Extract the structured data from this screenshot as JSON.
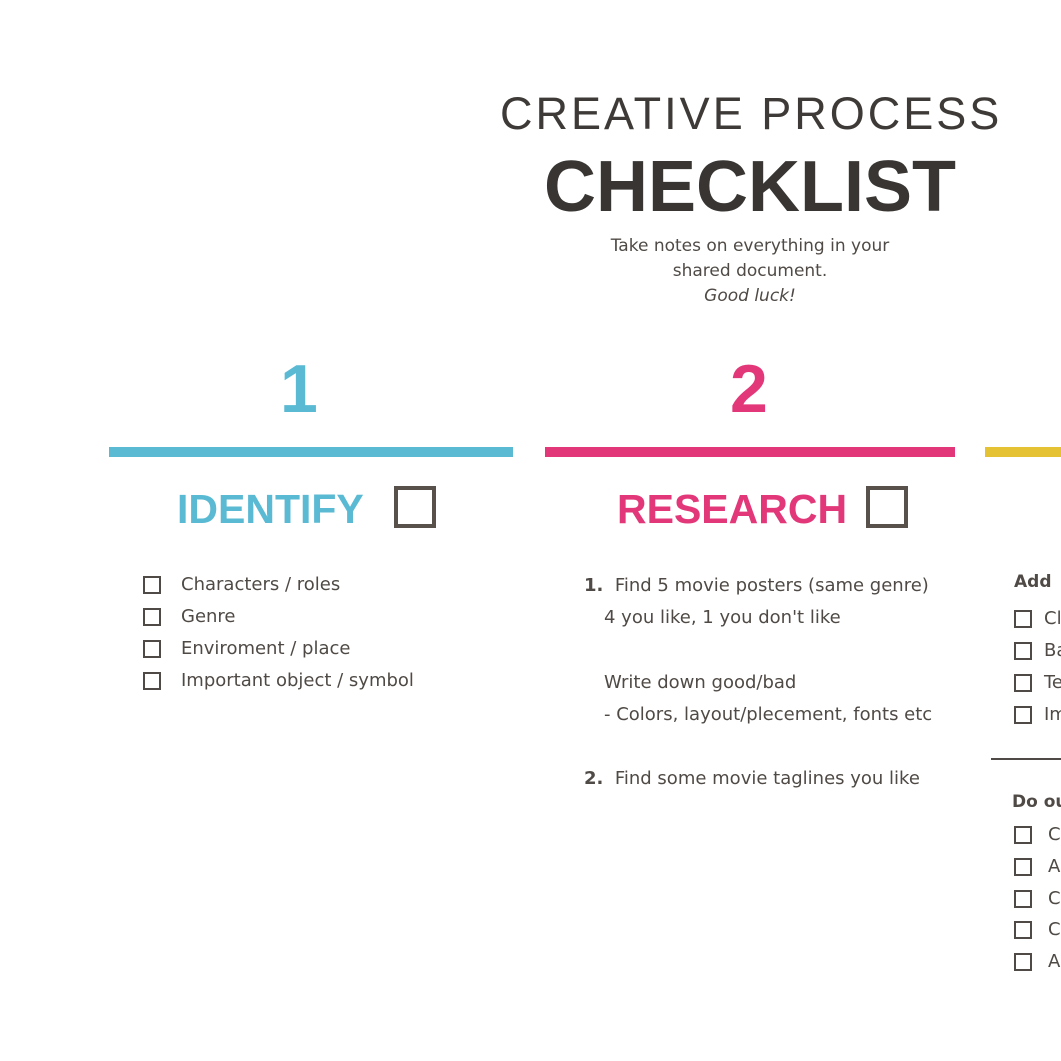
{
  "header": {
    "line1": "CREATIVE PROCESS",
    "line2": "CHECKLIST",
    "note1": "Take notes on everything in your",
    "note2": "shared document.",
    "note3": "Good luck!"
  },
  "colors": {
    "identify": "#5bbad3",
    "research": "#e2387a",
    "step3": "#e5c234",
    "text": "#4f4a45"
  },
  "steps": [
    {
      "number": "1",
      "title": "IDENTIFY",
      "items": [
        "Characters / roles",
        "Genre",
        "Enviroment / place",
        "Important object / symbol"
      ]
    },
    {
      "number": "2",
      "title": "RESEARCH",
      "items": [
        {
          "num": "1.",
          "lines": [
            "Find 5 movie posters (same genre)",
            "4 you like, 1 you don't like",
            "Write down good/bad",
            "- Colors, layout/plecement, fonts etc"
          ]
        },
        {
          "num": "2.",
          "lines": [
            "Find some movie taglines you like"
          ]
        }
      ]
    },
    {
      "section1": {
        "label": "Add",
        "items": [
          "Cl",
          "Ba",
          "Te",
          "Im"
        ]
      },
      "section2": {
        "label": "Do ou",
        "items": [
          "C",
          "A",
          "C",
          "C",
          "A"
        ]
      }
    }
  ]
}
